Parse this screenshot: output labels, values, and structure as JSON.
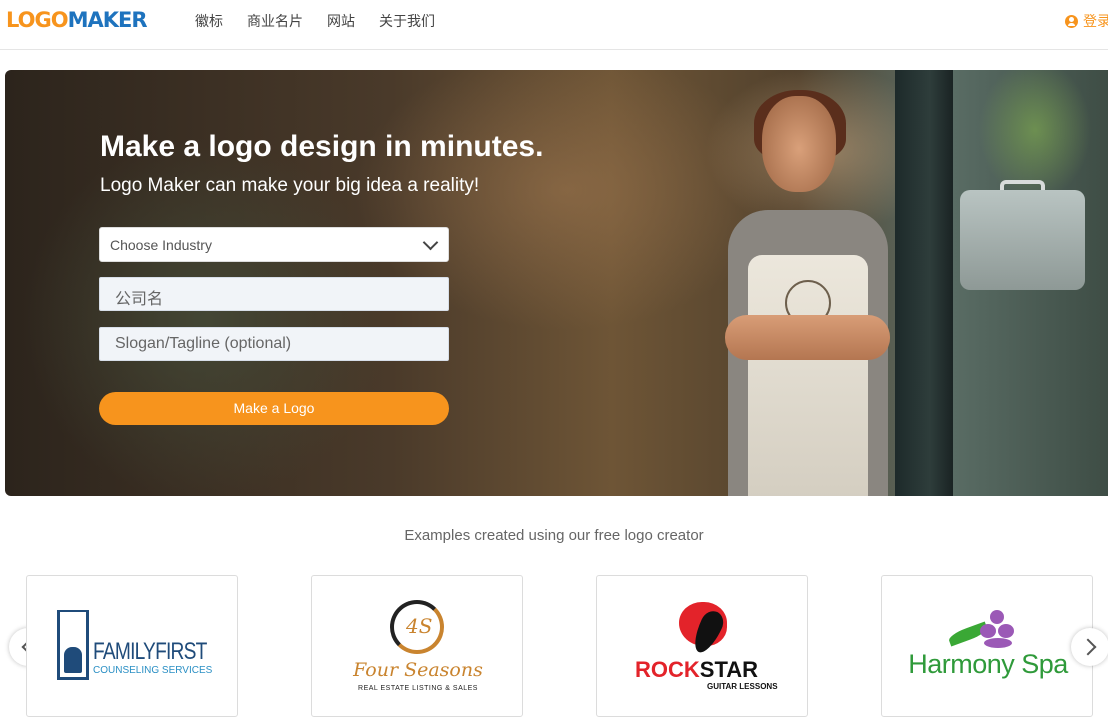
{
  "brand": {
    "logo_part1": "LOGO",
    "logo_part2": "MAKER",
    "color_primary": "#f7941d",
    "color_secondary": "#1e73be"
  },
  "nav": {
    "items": [
      {
        "label": "徽标"
      },
      {
        "label": "商业名片"
      },
      {
        "label": "网站"
      },
      {
        "label": "关于我们"
      }
    ]
  },
  "header": {
    "login_label": "登录",
    "login_icon": "user-circle-icon"
  },
  "hero": {
    "title": "Make a logo design in minutes.",
    "subtitle": "Logo Maker can make your big idea a reality!",
    "industry_select": {
      "value": "Choose Industry",
      "icon": "chevron-down-icon"
    },
    "company_input": {
      "placeholder": "公司名"
    },
    "slogan_input": {
      "placeholder": "Slogan/Tagline (optional)"
    },
    "cta_label": "Make a Logo"
  },
  "examples": {
    "title": "Examples created using our free logo creator",
    "prev_icon": "chevron-left-icon",
    "next_icon": "chevron-right-icon",
    "cards": [
      {
        "name": "FAMILYFIRST",
        "tagline": "COUNSELING SERVICES"
      },
      {
        "name": "Four Seasons",
        "tagline": "REAL ESTATE LISTING & SALES",
        "monogram": "4S"
      },
      {
        "name_part1": "ROCK",
        "name_part2": "STAR",
        "tagline": "GUITAR LESSONS"
      },
      {
        "name": "Harmony Spa"
      }
    ]
  }
}
